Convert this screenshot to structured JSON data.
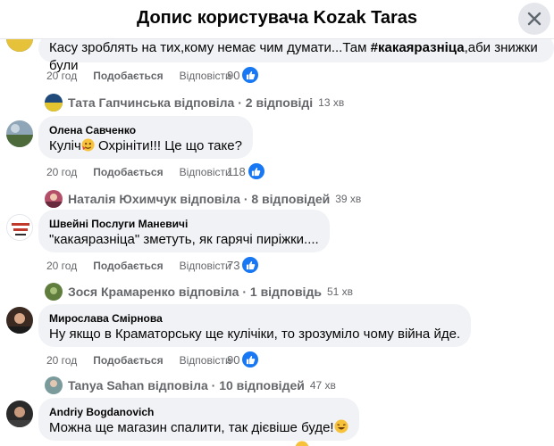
{
  "header": {
    "title": "Допис користувача Kozak Taras"
  },
  "comments": [
    {
      "text_before": "Касу зроблять на тих,кому немає чим думати...Там ",
      "hashtag": "#какаяразніца",
      "text_after": ",аби знижки були",
      "time": "20 год",
      "like": "Подобається",
      "reply": "Відповісти",
      "reactions": "90",
      "replies": {
        "label": "Тата Гапчинська відповіла · 2 відповіді",
        "time": "13 хв"
      }
    },
    {
      "author": "Олена Савченко",
      "text_before": "Куліч",
      "text_after": " Охрініти!!! Це що таке?",
      "time": "20 год",
      "like": "Подобається",
      "reply": "Відповісти",
      "reactions": "118",
      "replies": {
        "label": "Наталія Юхимчук відповіла · 8 відповідей",
        "time": "39 хв"
      }
    },
    {
      "author": "Швейні Послуги Маневичі",
      "text": "\"какаяразніца\" зметуть, як гарячі пиріжки....",
      "time": "20 год",
      "like": "Подобається",
      "reply": "Відповісти",
      "reactions": "73",
      "replies": {
        "label": "Зося Крамаренко відповіла · 1 відповідь",
        "time": "51 хв"
      }
    },
    {
      "author": "Мирослава Смірнова",
      "text": "Ну якщо в Краматорську ще кулічіки, то зрозуміло чому війна йде.",
      "time": "20 год",
      "like": "Подобається",
      "reply": "Відповісти",
      "reactions": "90",
      "replies": {
        "label": "Tanya Sahan відповіла · 10 відповідей",
        "time": "47 хв"
      }
    },
    {
      "author": "Andriy Bogdanovich",
      "text": "Можна ще магазин спалити, так дієвіше буде!"
    }
  ],
  "colors": {
    "accent": "#1877f2",
    "bubble": "#f0f2f5",
    "muted": "#65676b"
  },
  "icons": {
    "close": "close-icon",
    "like": "like-thumb-icon"
  }
}
